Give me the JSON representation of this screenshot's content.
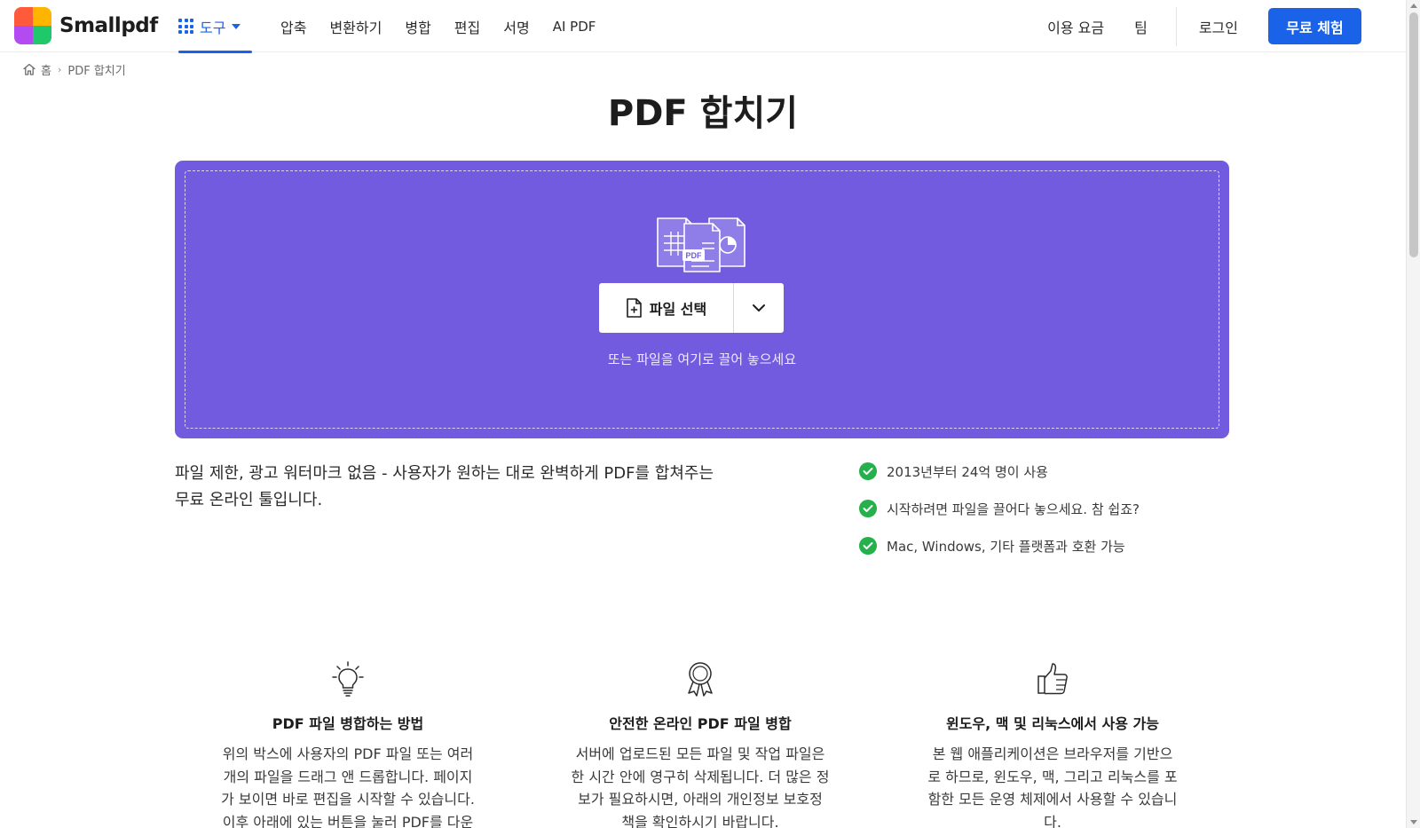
{
  "header": {
    "brand": "Smallpdf",
    "tools_label": "도구",
    "nav": [
      "압축",
      "변환하기",
      "병합",
      "편집",
      "서명",
      "AI PDF"
    ],
    "pricing": "이용 요금",
    "team": "팀",
    "login": "로그인",
    "trial": "무료 체험"
  },
  "breadcrumb": {
    "home": "홈",
    "current": "PDF 합치기"
  },
  "title": "PDF 합치기",
  "dropzone": {
    "choose_label": "파일 선택",
    "hint": "또는 파일을 여기로 끌어 놓으세요",
    "illustration_label": "PDF"
  },
  "description": {
    "line1": "파일 제한, 광고 워터마크 없음 - 사용자가 원하는 대로 완벽하게 PDF를 합쳐주는",
    "line2": "무료 온라인 툴입니다."
  },
  "features": [
    "2013년부터 24억 명이 사용",
    "시작하려면 파일을 끌어다 놓으세요. 참 쉽죠?",
    "Mac, Windows, 기타 플랫폼과 호환 가능"
  ],
  "columns": [
    {
      "icon": "lightbulb-icon",
      "title": "PDF 파일 병합하는 방법",
      "lines": [
        "위의 박스에 사용자의 PDF 파일 또는 여러",
        "개의 파일을 드래그 앤 드롭합니다. 페이지",
        "가 보이면 바로 편집을 시작할 수 있습니다.",
        "이후 아래에 있는 버튼을 눌러 PDF를 다운"
      ]
    },
    {
      "icon": "award-icon",
      "title": "안전한 온라인 PDF 파일 병합",
      "lines": [
        "서버에 업로드된 모든 파일 및 작업 파일은",
        "한 시간 안에 영구히 삭제됩니다. 더 많은 정",
        "보가 필요하시면, 아래의 개인정보 보호정",
        "책을 확인하시기 바랍니다."
      ]
    },
    {
      "icon": "thumbs-up-icon",
      "title": "윈도우, 맥 및 리눅스에서 사용 가능",
      "lines": [
        "본 웹 애플리케이션은 브라우저를 기반으",
        "로 하므로, 윈도우, 맥, 그리고 리눅스를 포",
        "함한 모든 운영 체제에서 사용할 수 있습니",
        "다."
      ]
    }
  ],
  "colors": {
    "accent": "#1a63e8",
    "dropzone": "#735be0",
    "check": "#24b04a"
  }
}
